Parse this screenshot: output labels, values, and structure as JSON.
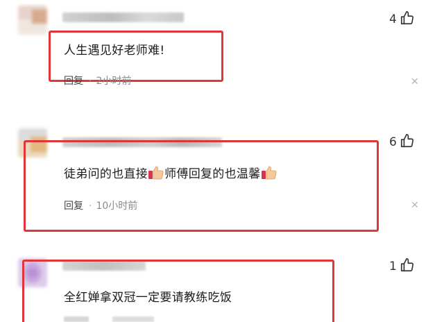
{
  "comments": [
    {
      "text": "人生遇见好老师难!",
      "reply_label": "回复",
      "separator": "·",
      "time": "2小时前",
      "likes": "4",
      "icons": {
        "like": "thumbs-up-icon",
        "close": "close-icon"
      }
    },
    {
      "text_part1": "徒弟问的也直接",
      "text_part2": "师傅回复的也温馨",
      "reply_label": "回复",
      "separator": "·",
      "time": "10小时前",
      "likes": "6",
      "icons": {
        "like": "thumbs-up-icon",
        "close": "close-icon",
        "emoji": "thumbs-up-emoji"
      }
    },
    {
      "text": "全红婵拿双冠一定要请教练吃饭",
      "likes": "1",
      "icons": {
        "like": "thumbs-up-icon"
      }
    }
  ],
  "colors": {
    "highlight_box": "#e0363a",
    "text": "#1c1c1c",
    "meta": "#8a8a8a"
  }
}
